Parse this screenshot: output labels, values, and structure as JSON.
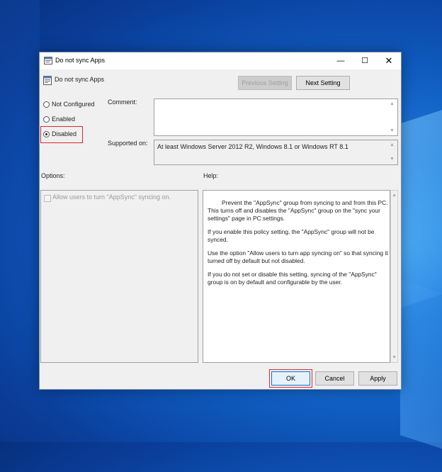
{
  "window": {
    "title": "Do not sync Apps",
    "header_title": "Do not sync Apps",
    "minimize_glyph": "—",
    "maximize_glyph": "☐",
    "close_glyph": "✕"
  },
  "nav": {
    "previous_label": "Previous Setting",
    "next_label": "Next Setting"
  },
  "state": {
    "options": [
      {
        "label": "Not Configured",
        "selected": false
      },
      {
        "label": "Enabled",
        "selected": false
      },
      {
        "label": "Disabled",
        "selected": true
      }
    ]
  },
  "fields": {
    "comment_label": "Comment:",
    "comment_value": "",
    "supported_label": "Supported on:",
    "supported_value": "At least Windows Server 2012 R2, Windows 8.1 or Windows RT 8.1"
  },
  "sections": {
    "options_label": "Options:",
    "help_label": "Help:"
  },
  "options_panel": {
    "checkbox_label": "Allow users to turn \"AppSync\" syncing on."
  },
  "help_panel": {
    "paragraphs": [
      "Prevent the \"AppSync\" group from syncing to and from this PC.  This turns off and disables the \"AppSync\" group on the \"sync your settings\" page in PC settings.",
      "If you enable this policy setting, the \"AppSync\" group will not be synced.",
      "Use the option \"Allow users to turn app syncing on\" so that syncing it turned off by default but not disabled.",
      "If you do not set or disable this setting, syncing of the \"AppSync\" group is on by default and configurable by the user."
    ]
  },
  "footer": {
    "ok_label": "OK",
    "cancel_label": "Cancel",
    "apply_label": "Apply"
  },
  "colors": {
    "highlight": "#e0272c",
    "accent": "#0078d7"
  }
}
